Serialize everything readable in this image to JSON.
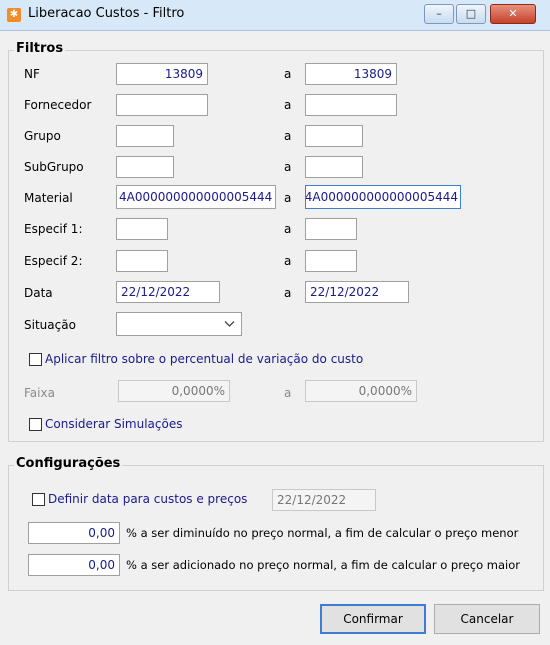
{
  "window": {
    "title": "Liberacao Custos - Filtro",
    "controls": {
      "minimize": "–",
      "maximize": "□",
      "close": "✕"
    }
  },
  "filtros": {
    "legend": "Filtros",
    "a_label": "a",
    "rows": [
      {
        "label": "NF",
        "from": "13809",
        "to": "13809"
      },
      {
        "label": "Fornecedor",
        "from": "",
        "to": ""
      },
      {
        "label": "Grupo",
        "from": "",
        "to": ""
      },
      {
        "label": "SubGrupo",
        "from": "",
        "to": ""
      },
      {
        "label": "Material",
        "from": "4A000000000000005444",
        "to": "4A000000000000005444"
      },
      {
        "label": "Especif 1:",
        "from": "",
        "to": ""
      },
      {
        "label": "Especif 2:",
        "from": "",
        "to": ""
      },
      {
        "label": "Data",
        "from": "22/12/2022",
        "to": "22/12/2022"
      }
    ],
    "situacao": {
      "label": "Situação",
      "value": ""
    },
    "percentual_check": {
      "label": "Aplicar filtro sobre o percentual de variação do custo",
      "checked": false
    },
    "faixa": {
      "label": "Faixa",
      "from": "0,0000%",
      "to": "0,0000%"
    },
    "simulacoes_check": {
      "label": "Considerar Simulações",
      "checked": false
    }
  },
  "configuracoes": {
    "legend": "Configurações",
    "data_check": {
      "label": "Definir data para custos e preços",
      "checked": false,
      "value": "22/12/2022"
    },
    "diminuido": {
      "value": "0,00",
      "label": "% a ser diminuído no preço normal, a fim de calcular o preço menor"
    },
    "adicionado": {
      "value": "0,00",
      "label": "% a ser adicionado no preço normal, a fim de calcular o preço maior"
    }
  },
  "buttons": {
    "confirmar": "Confirmar",
    "cancelar": "Cancelar"
  },
  "colors": {
    "value_text": "#1a1a8c",
    "focus_border": "#3c7fd0",
    "close_button": "#c5422b"
  },
  "icons": {
    "app": "app-logo-icon",
    "dropdown": "chevron-down-icon"
  }
}
